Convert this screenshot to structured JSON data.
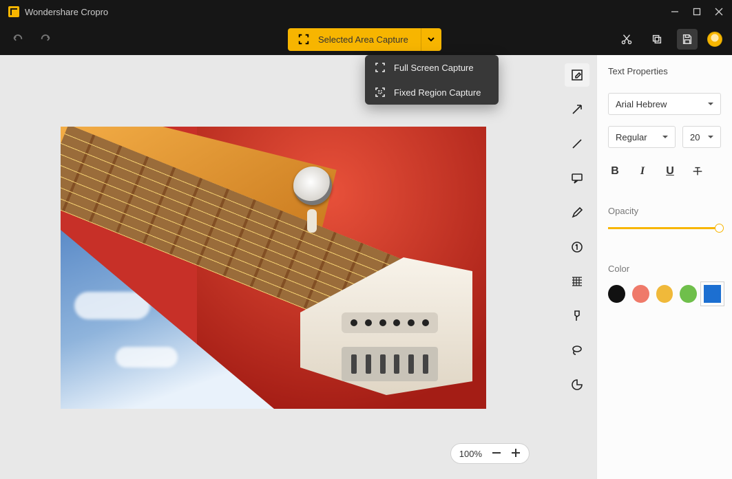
{
  "window": {
    "title": "Wondershare Cropro"
  },
  "toolbar": {
    "capture_label": "Selected Area Capture",
    "dropdown": [
      {
        "icon": "fullscreen-icon",
        "label": "Full Screen Capture"
      },
      {
        "icon": "fixed-region-icon",
        "label": "Fixed Region Capture"
      }
    ]
  },
  "zoom": {
    "value": "100%"
  },
  "tools": [
    {
      "name": "annotate-icon",
      "active": true
    },
    {
      "name": "arrow-icon"
    },
    {
      "name": "line-icon"
    },
    {
      "name": "callout-icon"
    },
    {
      "name": "pencil-icon"
    },
    {
      "name": "step-icon"
    },
    {
      "name": "blur-icon"
    },
    {
      "name": "highlighter-icon"
    },
    {
      "name": "lasso-icon"
    },
    {
      "name": "sticker-icon"
    }
  ],
  "props": {
    "title": "Text Properties",
    "font_family": "Arial Hebrew",
    "font_weight": "Regular",
    "font_size": "20",
    "opacity_label": "Opacity",
    "color_label": "Color",
    "colors": [
      {
        "hex": "#111111"
      },
      {
        "hex": "#ef7a6a"
      },
      {
        "hex": "#f0b93a"
      },
      {
        "hex": "#6fbf4b"
      },
      {
        "hex": "#1c6fd1",
        "selected": true
      }
    ]
  }
}
